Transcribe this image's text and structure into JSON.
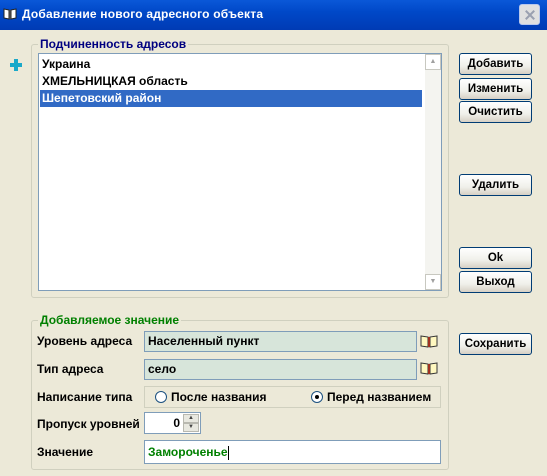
{
  "window": {
    "title": "Добавление нового адресного объекта"
  },
  "subordination": {
    "title": "Подчиненность адресов",
    "items": [
      {
        "label": "Украина",
        "selected": false
      },
      {
        "label": "ХМЕЛЬНИЦКАЯ область",
        "selected": false
      },
      {
        "label": "Шепетовский район",
        "selected": true
      }
    ]
  },
  "buttons": {
    "add": "Добавить",
    "edit": "Изменить",
    "clear": "Очистить",
    "delete": "Удалить",
    "ok": "Ok",
    "exit": "Выход",
    "save": "Сохранить"
  },
  "new_value": {
    "title": "Добавляемое значение",
    "level_label": "Уровень адреса",
    "level_value": "Населенный пункт",
    "type_label": "Тип адреса",
    "type_value": "село",
    "spelling_label": "Написание типа",
    "spelling_options": [
      "После названия",
      "Перед названием"
    ],
    "spelling_selected": "Перед названием",
    "skip_label": "Пропуск уровней",
    "skip_value": "0",
    "value_label": "Значение",
    "value_text": "Замороченье"
  },
  "colors": {
    "titlebar": "#0048c8",
    "selection": "#316ac5",
    "group_new_value_title": "#008000",
    "group_subordination_title": "#000080",
    "readonly_field": "#d7e5da",
    "value_text": "#008000"
  }
}
